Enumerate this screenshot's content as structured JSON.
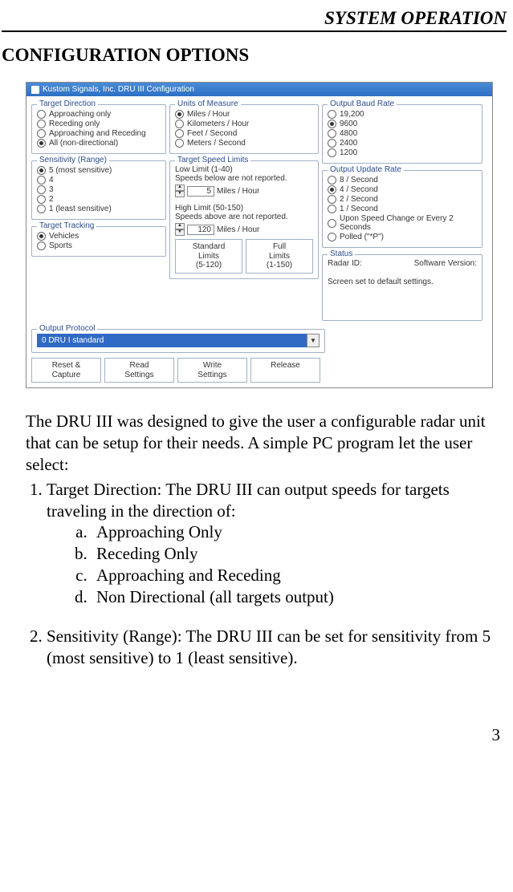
{
  "header": "SYSTEM OPERATION",
  "section": "CONFIGURATION OPTIONS",
  "dialog": {
    "title": "Kustom Signals, Inc.     DRU III Configuration",
    "groups": {
      "targetDirection": {
        "label": "Target Direction",
        "opts": [
          "Approaching only",
          "Receding only",
          "Approaching and Receding",
          "All (non-directional)"
        ],
        "sel": 3
      },
      "sensitivity": {
        "label": "Sensitivity (Range)",
        "opts": [
          "5  (most sensitive)",
          "4",
          "3",
          "2",
          "1  (least sensitive)"
        ],
        "sel": 0
      },
      "tracking": {
        "label": "Target Tracking",
        "opts": [
          "Vehicles",
          "Sports"
        ],
        "sel": 0
      },
      "units": {
        "label": "Units of Measure",
        "opts": [
          "Miles / Hour",
          "Kilometers / Hour",
          "Feet / Second",
          "Meters / Second"
        ],
        "sel": 0
      },
      "limits": {
        "label": "Target Speed Limits",
        "lowLabel": "Low Limit  (1-40)",
        "lowNote": "Speeds below are not reported.",
        "lowVal": "5",
        "lowUnit": "Miles / Hour",
        "highLabel": "High Limit  (50-150)",
        "highNote": "Speeds above are not reported.",
        "highVal": "120",
        "highUnit": "Miles / Hour",
        "stdBtn": "Standard\nLimits\n(5-120)",
        "fullBtn": "Full\nLimits\n(1-150)"
      },
      "baud": {
        "label": "Output Baud Rate",
        "opts": [
          "19,200",
          "9600",
          "4800",
          "2400",
          "1200"
        ],
        "sel": 1
      },
      "update": {
        "label": "Output Update Rate",
        "opts": [
          "8 / Second",
          "4 / Second",
          "2 / Second",
          "1 / Second",
          "Upon Speed Change or Every 2 Seconds",
          "Polled (\"*P\")"
        ],
        "sel": 1
      },
      "status": {
        "label": "Status",
        "idLabel": "Radar ID:",
        "verLabel": "Software Version:",
        "msg": "Screen set to default settings."
      },
      "protocol": {
        "label": "Output Protocol",
        "selLabel": "0  DRU I standard"
      }
    },
    "buttons": [
      "Reset &\nCapture",
      "Read\nSettings",
      "Write\nSettings",
      "Release"
    ]
  },
  "bodyIntro": "The DRU III was designed to give the user a configurable radar unit that can be setup for their needs.  A simple PC program let the user select:",
  "item1Lead": "Target Direction:  The DRU III can output speeds for targets traveling in the direction of:",
  "item1": {
    "a": "Approaching Only",
    "b": "Receding Only",
    "c": "Approaching and Receding",
    "d": "Non Directional (all targets output)"
  },
  "item2": "Sensitivity (Range):  The DRU III can be set for sensitivity from 5 (most sensitive) to 1 (least sensitive).",
  "pageNum": "3"
}
